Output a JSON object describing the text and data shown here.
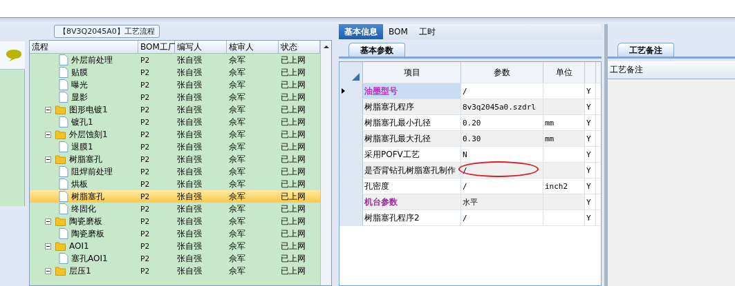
{
  "process_panel": {
    "title": "【8V3Q2045A0】工艺流程",
    "columns": [
      "流程",
      "BOM工厂",
      "编写人",
      "核审人",
      "状态"
    ],
    "tree": [
      {
        "kind": "continued",
        "children": [
          {
            "kind": "file",
            "label": "外层前处理",
            "bom_factory": "P2",
            "writer": "张自强",
            "reviewer": "佘军",
            "status": "已上网",
            "selected": false
          },
          {
            "kind": "file",
            "label": "贴膜",
            "bom_factory": "P2",
            "writer": "张自强",
            "reviewer": "佘军",
            "status": "已上网",
            "selected": false
          },
          {
            "kind": "file",
            "label": "曝光",
            "bom_factory": "P2",
            "writer": "张自强",
            "reviewer": "佘军",
            "status": "已上网",
            "selected": false
          },
          {
            "kind": "file",
            "label": "显影",
            "bom_factory": "P2",
            "writer": "张自强",
            "reviewer": "佘军",
            "status": "已上网",
            "selected": false
          }
        ]
      },
      {
        "kind": "folder",
        "label": "图形电镀1",
        "bom_factory": "P2",
        "writer": "张自强",
        "reviewer": "佘军",
        "status": "已上网",
        "selected": false,
        "expanded": true,
        "children": [
          {
            "kind": "file",
            "label": "镀孔1",
            "bom_factory": "P2",
            "writer": "张自强",
            "reviewer": "佘军",
            "status": "已上网",
            "selected": false
          }
        ]
      },
      {
        "kind": "folder",
        "label": "外层蚀刻1",
        "bom_factory": "P2",
        "writer": "张自强",
        "reviewer": "佘军",
        "status": "已上网",
        "selected": false,
        "expanded": true,
        "children": [
          {
            "kind": "file",
            "label": "退膜1",
            "bom_factory": "P2",
            "writer": "张自强",
            "reviewer": "佘军",
            "status": "已上网",
            "selected": false
          }
        ]
      },
      {
        "kind": "folder",
        "label": "树脂塞孔",
        "bom_factory": "P2",
        "writer": "张自强",
        "reviewer": "佘军",
        "status": "已上网",
        "selected": false,
        "expanded": true,
        "children": [
          {
            "kind": "file",
            "label": "阻焊前处理",
            "bom_factory": "P2",
            "writer": "张自强",
            "reviewer": "佘军",
            "status": "已上网",
            "selected": false
          },
          {
            "kind": "file",
            "label": "烘板",
            "bom_factory": "P2",
            "writer": "张自强",
            "reviewer": "佘军",
            "status": "已上网",
            "selected": false
          },
          {
            "kind": "file",
            "label": "树脂塞孔",
            "bom_factory": "P2",
            "writer": "张自强",
            "reviewer": "佘军",
            "status": "已上网",
            "selected": true
          },
          {
            "kind": "file",
            "label": "终固化",
            "bom_factory": "P2",
            "writer": "张自强",
            "reviewer": "佘军",
            "status": "已上网",
            "selected": false
          }
        ]
      },
      {
        "kind": "folder",
        "label": "陶瓷磨板",
        "bom_factory": "P2",
        "writer": "张自强",
        "reviewer": "佘军",
        "status": "已上网",
        "selected": false,
        "expanded": true,
        "children": [
          {
            "kind": "file",
            "label": "陶瓷磨板",
            "bom_factory": "P2",
            "writer": "张自强",
            "reviewer": "佘军",
            "status": "已上网",
            "selected": false
          }
        ]
      },
      {
        "kind": "folder",
        "label": "AOI1",
        "bom_factory": "P2",
        "writer": "张自强",
        "reviewer": "佘军",
        "status": "已上网",
        "selected": false,
        "expanded": true,
        "children": [
          {
            "kind": "file",
            "label": "塞孔AOI1",
            "bom_factory": "P2",
            "writer": "张自强",
            "reviewer": "佘军",
            "status": "已上网",
            "selected": false
          }
        ]
      },
      {
        "kind": "folder",
        "label": "层压1",
        "bom_factory": "P2",
        "writer": "张自强",
        "reviewer": "佘军",
        "status": "已上网",
        "selected": false,
        "expanded": true
      }
    ]
  },
  "tabs": [
    {
      "label": "基本信息",
      "selected": true
    },
    {
      "label": "BOM",
      "selected": false
    },
    {
      "label": "工时",
      "selected": false
    }
  ],
  "sub_tab": "基本参数",
  "params": {
    "columns": [
      "项目",
      "参数",
      "单位"
    ],
    "rows": [
      {
        "item": "油墨型号",
        "value": "/",
        "unit": "",
        "column_4": "Y",
        "color": "#c020c0",
        "selected": true
      },
      {
        "item": "树脂塞孔程序",
        "value": "8v3q2045a0.szdrl",
        "unit": "",
        "column_4": "Y",
        "selected": false
      },
      {
        "item": "树脂塞孔最小孔径",
        "value": "0.20",
        "unit": "mm",
        "column_4": "Y",
        "selected": false
      },
      {
        "item": "树脂塞孔最大孔径",
        "value": "0.30",
        "unit": "mm",
        "column_4": "Y",
        "selected": false
      },
      {
        "item": "采用POFV工艺",
        "value": "N",
        "unit": "",
        "column_4": "Y",
        "selected": false
      },
      {
        "item": "是否背钻孔树脂塞孔制作",
        "value": "/",
        "unit": "",
        "column_4": "Y",
        "selected": false,
        "circled": true
      },
      {
        "item": "孔密度",
        "value": "/",
        "unit": "inch2",
        "column_4": "Y",
        "selected": false
      },
      {
        "item": "机台参数",
        "value": "水平",
        "unit": "",
        "column_4": "Y",
        "color": "#a020a0",
        "selected": false
      },
      {
        "item": "树脂塞孔程序2",
        "value": "/",
        "unit": "",
        "column_4": "Y",
        "selected": false
      }
    ]
  },
  "notes_panel": {
    "tab": "工艺备注",
    "label": "工艺备注"
  }
}
